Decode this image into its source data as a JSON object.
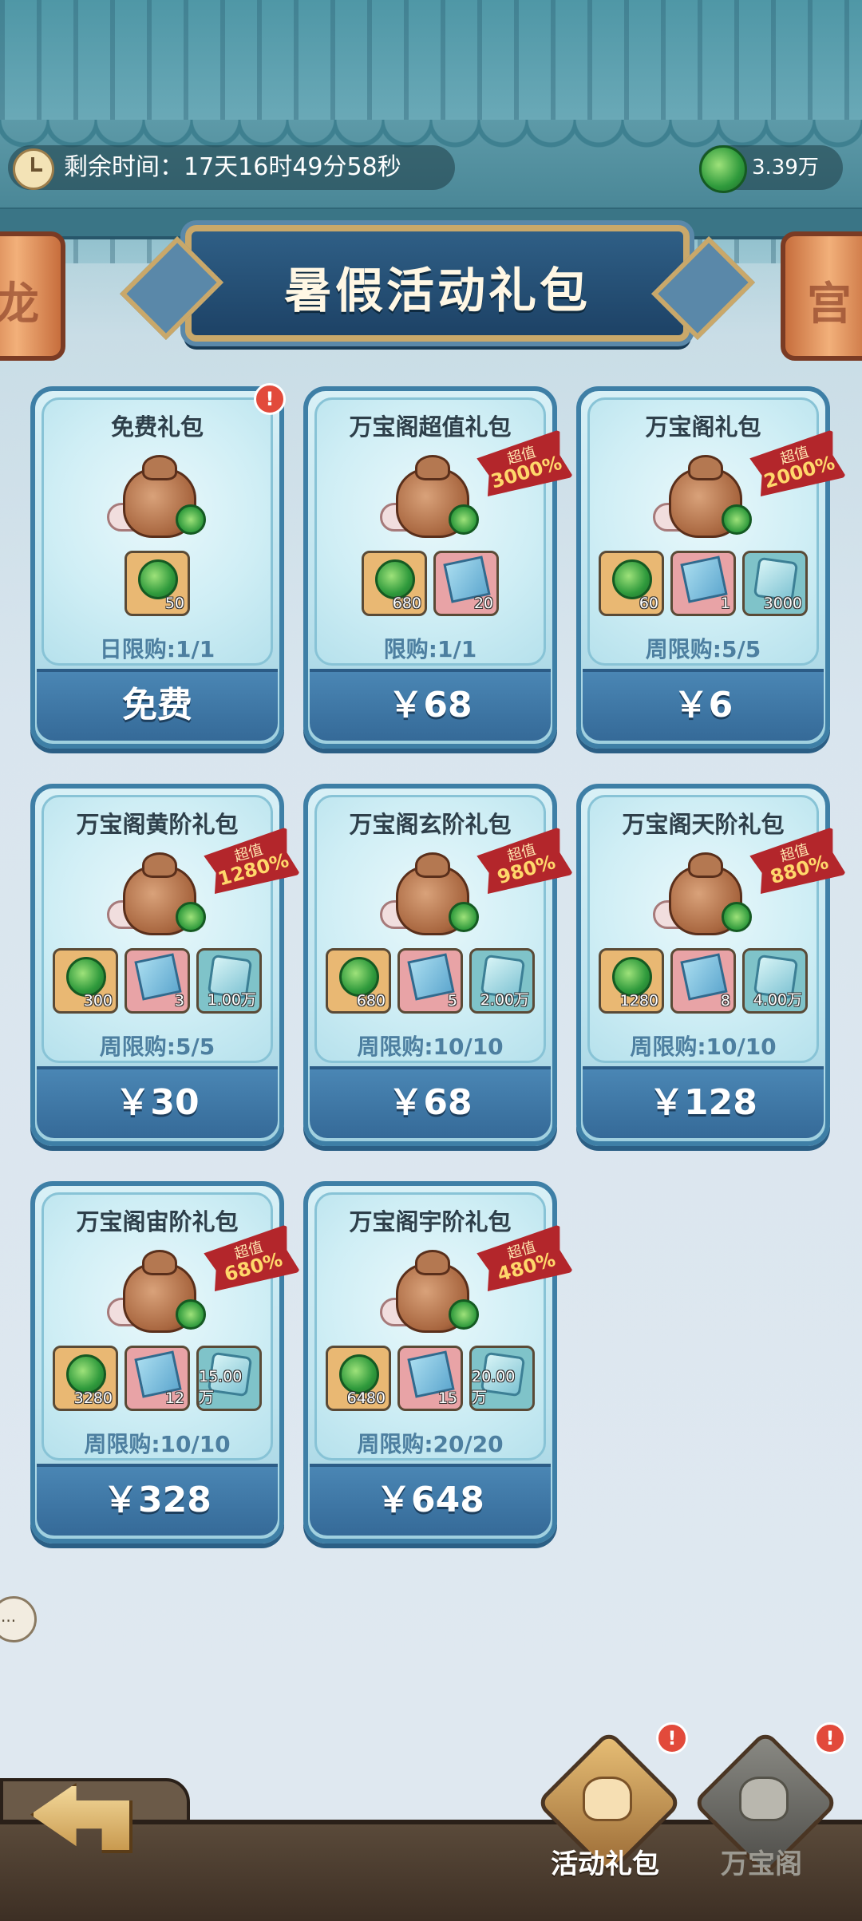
{
  "header": {
    "timer_label": "剩余时间：17天16时49分58秒",
    "currency": "3.39万",
    "banner_title": "暑假活动礼包"
  },
  "lanterns": [
    "龙",
    "宫"
  ],
  "packs": [
    {
      "name": "免费礼包",
      "badge": null,
      "items": [
        {
          "type": "jade",
          "qty": "50"
        }
      ],
      "limit": "日限购:1/1",
      "price": "免费",
      "alert": true
    },
    {
      "name": "万宝阁超值礼包",
      "badge": {
        "label": "超值",
        "pct": "3000%"
      },
      "items": [
        {
          "type": "jade",
          "qty": "680"
        },
        {
          "type": "scroll",
          "qty": "20"
        }
      ],
      "limit": "限购:1/1",
      "price": "￥68"
    },
    {
      "name": "万宝阁礼包",
      "badge": {
        "label": "超值",
        "pct": "2000%"
      },
      "items": [
        {
          "type": "jade",
          "qty": "60"
        },
        {
          "type": "scroll",
          "qty": "1"
        },
        {
          "type": "crystal",
          "qty": "3000"
        }
      ],
      "limit": "周限购:5/5",
      "price": "￥6"
    },
    {
      "name": "万宝阁黄阶礼包",
      "badge": {
        "label": "超值",
        "pct": "1280%"
      },
      "items": [
        {
          "type": "jade",
          "qty": "300"
        },
        {
          "type": "scroll",
          "qty": "3"
        },
        {
          "type": "crystal",
          "qty": "1.00万"
        }
      ],
      "limit": "周限购:5/5",
      "price": "￥30"
    },
    {
      "name": "万宝阁玄阶礼包",
      "badge": {
        "label": "超值",
        "pct": "980%"
      },
      "items": [
        {
          "type": "jade",
          "qty": "680"
        },
        {
          "type": "scroll",
          "qty": "5"
        },
        {
          "type": "crystal",
          "qty": "2.00万"
        }
      ],
      "limit": "周限购:10/10",
      "price": "￥68"
    },
    {
      "name": "万宝阁天阶礼包",
      "badge": {
        "label": "超值",
        "pct": "880%"
      },
      "items": [
        {
          "type": "jade",
          "qty": "1280"
        },
        {
          "type": "scroll",
          "qty": "8"
        },
        {
          "type": "crystal",
          "qty": "4.00万"
        }
      ],
      "limit": "周限购:10/10",
      "price": "￥128"
    },
    {
      "name": "万宝阁宙阶礼包",
      "badge": {
        "label": "超值",
        "pct": "680%"
      },
      "items": [
        {
          "type": "jade",
          "qty": "3280"
        },
        {
          "type": "scroll",
          "qty": "12"
        },
        {
          "type": "crystal",
          "qty": "15.00万"
        }
      ],
      "limit": "周限购:10/10",
      "price": "￥328"
    },
    {
      "name": "万宝阁宇阶礼包",
      "badge": {
        "label": "超值",
        "pct": "480%"
      },
      "items": [
        {
          "type": "jade",
          "qty": "6480"
        },
        {
          "type": "scroll",
          "qty": "15"
        },
        {
          "type": "crystal",
          "qty": "20.00万"
        }
      ],
      "limit": "周限购:20/20",
      "price": "￥648"
    }
  ],
  "bottom_tabs": [
    {
      "label": "活动礼包",
      "active": true,
      "alert": true
    },
    {
      "label": "万宝阁",
      "active": false,
      "alert": true
    }
  ],
  "alert_mark": "!",
  "chat_icon": "...",
  "colors": {
    "accent_red": "#b3262b",
    "card_border": "#3e7fa6",
    "price_bar": "#356a98"
  }
}
